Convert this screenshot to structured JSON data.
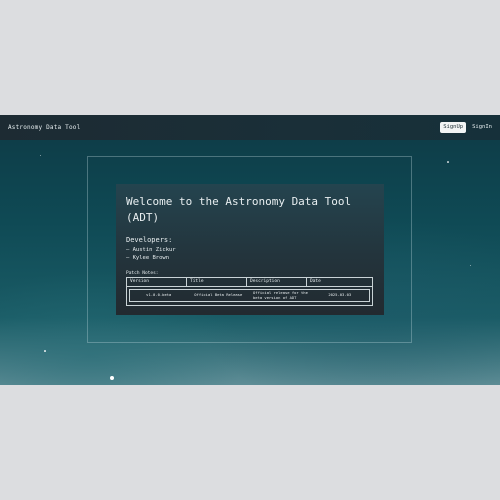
{
  "app": {
    "brand": "Astronomy Data Tool"
  },
  "nav": {
    "signup_label": "SignUp",
    "signin_label": "SignIn"
  },
  "main": {
    "title": "Welcome to the Astronomy Data Tool (ADT)",
    "developers_heading": "Developers:",
    "developers": [
      "— Austin Zickur",
      "— Kylee Brown"
    ],
    "patch_notes_heading": "Patch Notes:",
    "patch_table": {
      "columns": [
        "Version",
        "Title",
        "Description",
        "Date"
      ],
      "rows": [
        {
          "version": "v1.0.0-beta",
          "title": "Official Beta Release",
          "description": "Official release for the beta version of ADT",
          "date": "2025-03-03"
        }
      ]
    }
  },
  "colors": {
    "navbar": "#1d2b33",
    "panel": "#23343c",
    "text": "#e8eef0"
  }
}
